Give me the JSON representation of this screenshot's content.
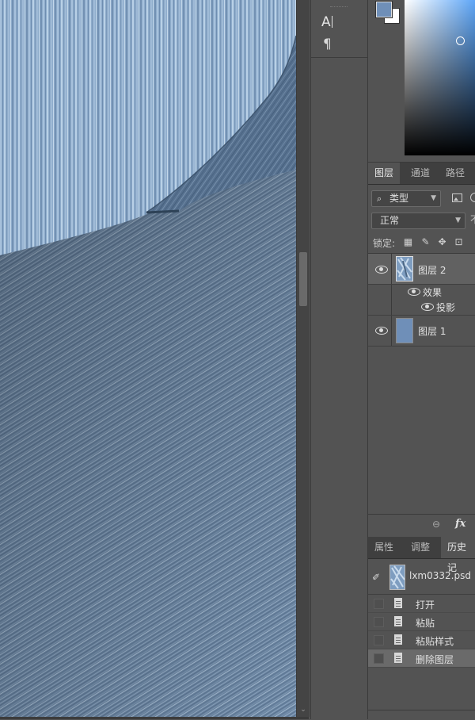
{
  "colors": {
    "foreground": "#6f8fb8",
    "background": "#ffffff",
    "canvas_base": "#6f89a6",
    "panel_bg": "#535353"
  },
  "toolstrip": {
    "text_tool_glyph": "A",
    "paragraph_tool_glyph": "¶"
  },
  "layers_panel": {
    "tabs": [
      {
        "label": "图层",
        "active": true
      },
      {
        "label": "通道",
        "active": false
      },
      {
        "label": "路径",
        "active": false
      }
    ],
    "filter": {
      "label": "类型",
      "icon": "search-icon"
    },
    "blend_mode": "正常",
    "opacity_label_partial": "不",
    "lock_label": "锁定:",
    "lock_icons": [
      "lock-transparent-icon",
      "lock-paint-icon",
      "lock-move-icon",
      "lock-artboard-icon"
    ],
    "layers": [
      {
        "name": "图层 2",
        "visible": true,
        "selected": true,
        "thumb": "texture"
      },
      {
        "name": "效果",
        "visible": true,
        "is_effect_group": true
      },
      {
        "name": "投影",
        "visible": true,
        "is_effect": true
      },
      {
        "name": "图层 1",
        "visible": true,
        "selected": false,
        "thumb": "solid"
      }
    ],
    "footer_icons": [
      "link-icon",
      "fx-icon"
    ],
    "fx_label": "fx"
  },
  "history_panel": {
    "tabs": [
      {
        "label": "属性",
        "active": false
      },
      {
        "label": "调整",
        "active": false
      },
      {
        "label": "历史记",
        "active": true
      }
    ],
    "snapshot_name": "lxm0332.psd",
    "steps": [
      {
        "label": "打开",
        "selected": false
      },
      {
        "label": "粘贴",
        "selected": false
      },
      {
        "label": "粘贴样式",
        "selected": false
      },
      {
        "label": "删除图层",
        "selected": true
      }
    ]
  }
}
